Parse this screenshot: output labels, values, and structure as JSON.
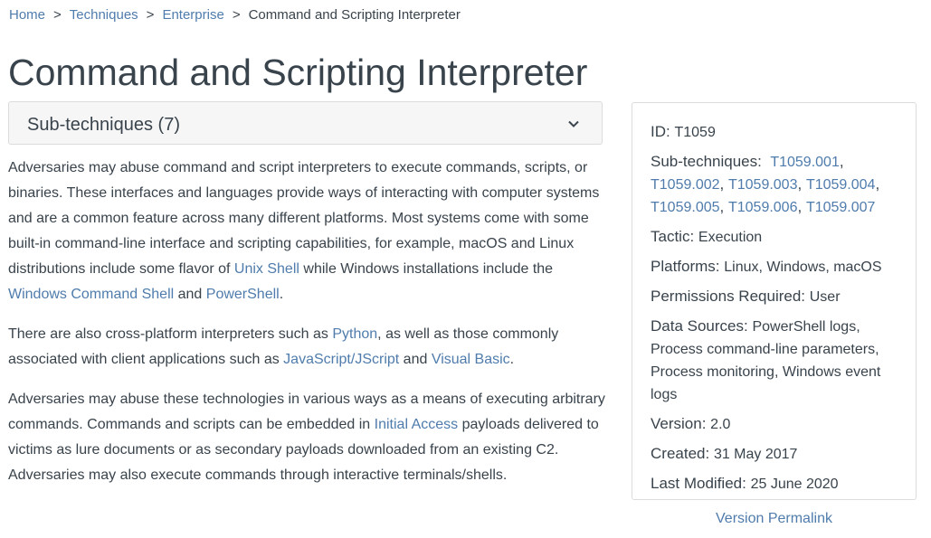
{
  "breadcrumb": {
    "items": [
      {
        "label": "Home"
      },
      {
        "label": "Techniques"
      },
      {
        "label": "Enterprise"
      },
      {
        "label": "Command and Scripting Interpreter"
      }
    ],
    "separator": ">"
  },
  "page": {
    "title": "Command and Scripting Interpreter"
  },
  "subtechniques_card": {
    "label": "Sub-techniques (7)",
    "icon": "chevron-down-icon"
  },
  "description": {
    "p1": {
      "t1": "Adversaries may abuse command and script interpreters to execute commands, scripts, or binaries. These interfaces and languages provide ways of interacting with computer systems and are a common feature across many different platforms. Most systems come with some built-in command-line interface and scripting capabilities, for example, macOS and Linux distributions include some flavor of ",
      "link1": "Unix Shell",
      "t2": " while Windows installations include the ",
      "link2": "Windows Command Shell",
      "t3": " and ",
      "link3": "PowerShell",
      "t4": "."
    },
    "p2": {
      "t1": "There are also cross-platform interpreters such as ",
      "link1": "Python",
      "t2": ", as well as those commonly associated with client applications such as ",
      "link2": "JavaScript/JScript",
      "t3": " and ",
      "link3": "Visual Basic",
      "t4": "."
    },
    "p3": {
      "t1": "Adversaries may abuse these technologies in various ways as a means of executing arbitrary commands. Commands and scripts can be embedded in ",
      "link1": "Initial Access",
      "t2": " payloads delivered to victims as lure documents or as secondary payloads downloaded from an existing C2. Adversaries may also execute commands through interactive terminals/shells."
    }
  },
  "info": {
    "id_label": "ID:",
    "id_value": "T1059",
    "subtech_label": "Sub-techniques:",
    "subtech_links": [
      "T1059.001",
      "T1059.002",
      "T1059.003",
      "T1059.004",
      "T1059.005",
      "T1059.006",
      "T1059.007"
    ],
    "tactic_label": "Tactic:",
    "tactic_value": "Execution",
    "platforms_label": "Platforms:",
    "platforms_value": "Linux, Windows, macOS",
    "permissions_label": "Permissions Required:",
    "permissions_value": "User",
    "datasources_label": "Data Sources:",
    "datasources_value": "PowerShell logs, Process command-line parameters, Process monitoring, Windows event logs",
    "version_label": "Version:",
    "version_value": "2.0",
    "created_label": "Created:",
    "created_value": "31 May 2017",
    "modified_label": "Last Modified:",
    "modified_value": "25 June 2020"
  },
  "permalink": {
    "label": "Version Permalink"
  },
  "colors": {
    "text": "#39434c",
    "link": "#4f7cac",
    "card_bg": "#f6f6f6",
    "border": "#dcdcdc"
  }
}
